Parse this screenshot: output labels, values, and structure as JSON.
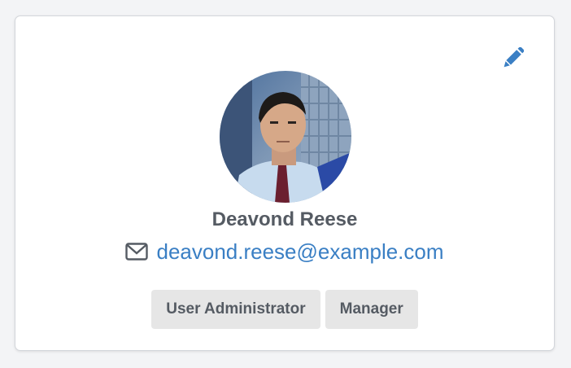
{
  "profile": {
    "name": "Deavond Reese",
    "email": "deavond.reese@example.com",
    "roles": [
      "User Administrator",
      "Manager"
    ]
  },
  "icons": {
    "edit": "pencil-icon",
    "email": "envelope-icon"
  },
  "colors": {
    "accent": "#3a7fc4",
    "text": "#555b63",
    "badge_bg": "#e6e6e6",
    "card_bg": "#ffffff",
    "page_bg": "#f3f4f6"
  }
}
